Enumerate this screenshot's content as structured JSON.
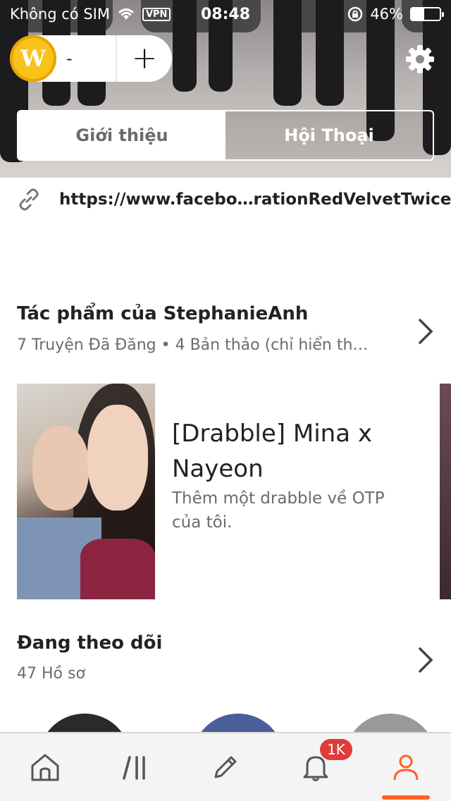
{
  "status_bar": {
    "carrier": "Không có SIM",
    "vpn": "VPN",
    "time": "08:48",
    "battery": "46%",
    "battery_level": 0.46
  },
  "header": {
    "coin_count": "-",
    "coin_symbol": "W",
    "add_label": "+",
    "settings_icon": "gear-icon"
  },
  "toggle": {
    "about": "Giới thiệu",
    "conversations": "Hội Thoại"
  },
  "profile": {
    "link": "https://www.facebo…rationRedVelvetTwice"
  },
  "works": {
    "title": "Tác phẩm của StephanieAnh",
    "subtitle": "7 Truyện Đã Đăng • 4 Bản thảo (chỉ hiển th…",
    "story": {
      "title": "[Drabble] Mina x Nayeon",
      "description": "Thêm một drabble về OTP của tôi."
    }
  },
  "following": {
    "title": "Đang theo dõi",
    "subtitle": "47 Hồ sơ"
  },
  "tabbar": {
    "items": [
      {
        "icon": "home-icon"
      },
      {
        "icon": "library-icon"
      },
      {
        "icon": "pencil-icon"
      },
      {
        "icon": "bell-icon",
        "badge": "1K"
      },
      {
        "icon": "profile-icon"
      }
    ],
    "accent": "#ff6122"
  },
  "colors": {
    "coin": "#f9c21a",
    "badge": "#e23a3a",
    "active_tab": "#ff6122"
  }
}
